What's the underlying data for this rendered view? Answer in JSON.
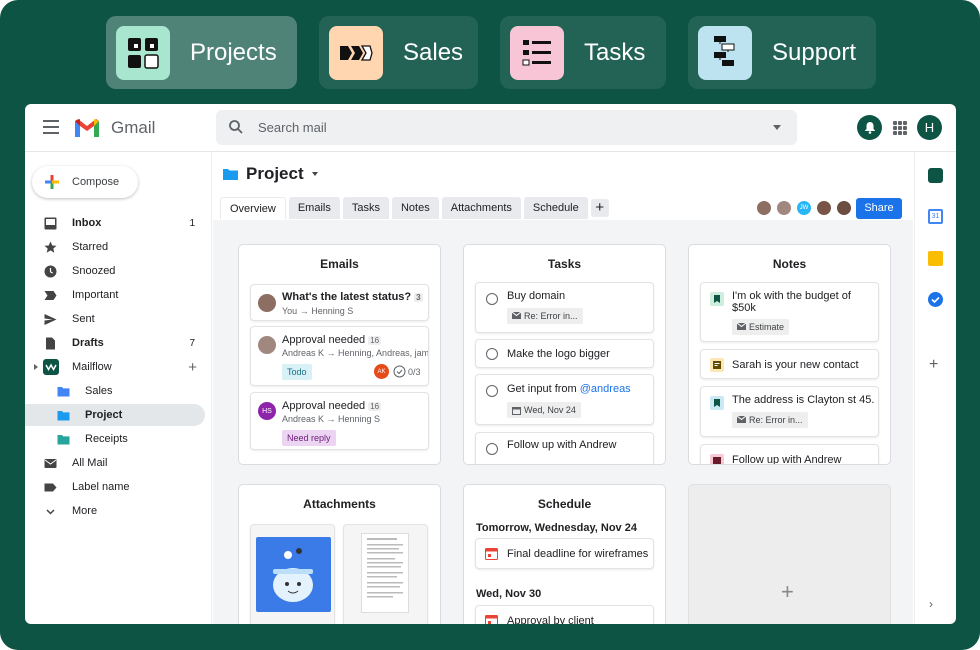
{
  "workspaces": [
    {
      "label": "Projects",
      "color": "#a8e6cf",
      "active": true,
      "icon": "projects-grid-icon"
    },
    {
      "label": "Sales",
      "color": "#ffd6b0",
      "active": false,
      "icon": "sales-pipeline-icon"
    },
    {
      "label": "Tasks",
      "color": "#f7c5d6",
      "active": false,
      "icon": "tasks-list-icon"
    },
    {
      "label": "Support",
      "color": "#bde3f0",
      "active": false,
      "icon": "support-flow-icon"
    }
  ],
  "header": {
    "app_name": "Gmail",
    "search_placeholder": "Search mail",
    "avatar_letter": "H"
  },
  "sidebar": {
    "compose": "Compose",
    "items": [
      {
        "label": "Inbox",
        "count": "1",
        "icon": "inbox-icon",
        "bold": true
      },
      {
        "label": "Starred",
        "count": "",
        "icon": "star-icon"
      },
      {
        "label": "Snoozed",
        "count": "",
        "icon": "clock-icon"
      },
      {
        "label": "Important",
        "count": "",
        "icon": "important-icon"
      },
      {
        "label": "Sent",
        "count": "",
        "icon": "send-icon"
      },
      {
        "label": "Drafts",
        "count": "7",
        "icon": "draft-icon",
        "bold": true
      },
      {
        "label": "Mailflow",
        "count": "+",
        "icon": "mailflow-icon"
      },
      {
        "label": "Sales",
        "icon": "folder-icon",
        "sub": true
      },
      {
        "label": "Project",
        "icon": "folder-icon",
        "sub": true,
        "selected": true
      },
      {
        "label": "Receipts",
        "icon": "folder-icon",
        "sub": true
      },
      {
        "label": "All Mail",
        "icon": "all-mail-icon"
      },
      {
        "label": "Label name",
        "icon": "label-icon"
      },
      {
        "label": "More",
        "icon": "chevron-down-icon"
      }
    ]
  },
  "project": {
    "title": "Project",
    "tabs": [
      "Overview",
      "Emails",
      "Tasks",
      "Notes",
      "Attachments",
      "Schedule"
    ],
    "collaborators": [
      {
        "initials": "",
        "color": "#8d6e63"
      },
      {
        "initials": "",
        "color": "#a1887f"
      },
      {
        "initials": "JW",
        "color": "#29b6f6"
      },
      {
        "initials": "",
        "color": "#795548"
      },
      {
        "initials": "",
        "color": "#6d4c41"
      }
    ],
    "share": "Share"
  },
  "emails": {
    "title": "Emails",
    "items": [
      {
        "subject": "What's the latest status?",
        "count": "3",
        "participants": "You → Henning S",
        "avatar_color": "#8d6e63",
        "avatar_initials": ""
      },
      {
        "subject": "Approval needed",
        "count": "16",
        "participants": "Andreas K → Henning, Andreas, jami",
        "avatar_color": "#a1887f",
        "avatar_initials": "",
        "chip": "Todo",
        "chip_color": "#d7f1f7",
        "chip_text": "#1a6e83",
        "assignee": "AK",
        "progress": "0/3"
      },
      {
        "subject": "Approval needed",
        "count": "16",
        "participants": "Andreas K → Henning S",
        "avatar_color": "#8e24aa",
        "avatar_initials": "HS",
        "chip": "Need reply",
        "chip_color": "#ecd5f2",
        "chip_text": "#6a1b7a"
      }
    ]
  },
  "tasks": {
    "title": "Tasks",
    "items": [
      {
        "label": "Buy domain",
        "attachment": "Re: Error in..."
      },
      {
        "label": "Make the logo bigger"
      },
      {
        "label_prefix": "Get input from ",
        "mention": "@andreas",
        "date": "Wed, Nov 24"
      },
      {
        "label": "Follow up with Andrew"
      }
    ]
  },
  "notes": {
    "title": "Notes",
    "items": [
      {
        "text": "I'm ok with the budget of $50k",
        "chip": "Estimate",
        "color": "#cdeedd"
      },
      {
        "text": "Sarah is your new contact",
        "color": "#fde6b5"
      },
      {
        "text": "The address is Clayton st 45.",
        "chip": "Re: Error in...",
        "color": "#cbe8f5"
      },
      {
        "text": "Follow up with Andrew",
        "color": "#f7cad5"
      }
    ]
  },
  "attachments": {
    "title": "Attachments"
  },
  "schedule": {
    "title": "Schedule",
    "groups": [
      {
        "date": "Tomorrow, Wednesday, Nov 24",
        "event": "Final deadline for wireframes"
      },
      {
        "date": "Wed, Nov 30",
        "event": "Approval by client"
      }
    ]
  },
  "add_panel": {
    "symbol": "+"
  },
  "colors": {
    "brand": "#0d5445",
    "accent": "#1a73e8",
    "mention": "#1a73e8"
  }
}
